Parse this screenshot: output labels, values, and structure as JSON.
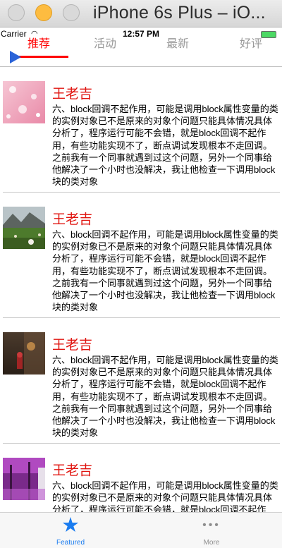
{
  "window": {
    "title": "iPhone 6s Plus – iO..."
  },
  "status_bar": {
    "carrier": "Carrier",
    "time": "12:57 PM"
  },
  "top_tabs": [
    {
      "label": "推荐",
      "active": true
    },
    {
      "label": "活动",
      "active": false
    },
    {
      "label": "最新",
      "active": false
    },
    {
      "label": "好评",
      "active": false
    }
  ],
  "feed": [
    {
      "image": "pink-flowers-photo",
      "title": "王老吉",
      "body": "六、block回调不起作用，可能是调用block属性变量的类的实例对象已不是原来的对象个问题只能具体情况具体分析了，程序运行可能不会错，就是block回调不起作用，有些功能实现不了，断点调试发现根本不走回调。之前我有一个同事就遇到过这个问题，另外一个同事给他解决了一个小时也没解决，我让他检查一下调用block块的类对象"
    },
    {
      "image": "mountain-meadow-photo",
      "title": "王老吉",
      "body": "六、block回调不起作用，可能是调用block属性变量的类的实例对象已不是原来的对象个问题只能具体情况具体分析了，程序运行可能不会错，就是block回调不起作用，有些功能实现不了，断点调试发现根本不走回调。之前我有一个同事就遇到过这个问题，另外一个同事给他解决了一个小时也没解决，我让他检查一下调用block块的类对象"
    },
    {
      "image": "rainy-street-photo",
      "title": "王老吉",
      "body": "六、block回调不起作用，可能是调用block属性变量的类的实例对象已不是原来的对象个问题只能具体情况具体分析了，程序运行可能不会错，就是block回调不起作用，有些功能实现不了，断点调试发现根本不走回调。之前我有一个同事就遇到过这个问题，另外一个同事给他解决了一个小时也没解决，我让他检查一下调用block块的类对象"
    },
    {
      "image": "purple-trees-photo",
      "title": "王老吉",
      "body": "六、block回调不起作用，可能是调用block属性变量的类的实例对象已不是原来的对象个问题只能具体情况具体分析了，程序运行可能不会错，就是block回调不起作用，有些功能实现不了，断点调试发现根本不走回调。之前我有一个同事就遇到过这个问题，另外一个同事给他解决了一个小时也没解决，我让他检查一下调用block块的类对象"
    }
  ],
  "tab_bar": {
    "featured": {
      "label": "Featured",
      "icon": "star-icon"
    },
    "more": {
      "label": "More",
      "icon": "more-dots-icon"
    }
  },
  "colors": {
    "accent_red": "#ff0000",
    "title_red": "#e0140f",
    "tab_blue": "#1a7cf0"
  }
}
